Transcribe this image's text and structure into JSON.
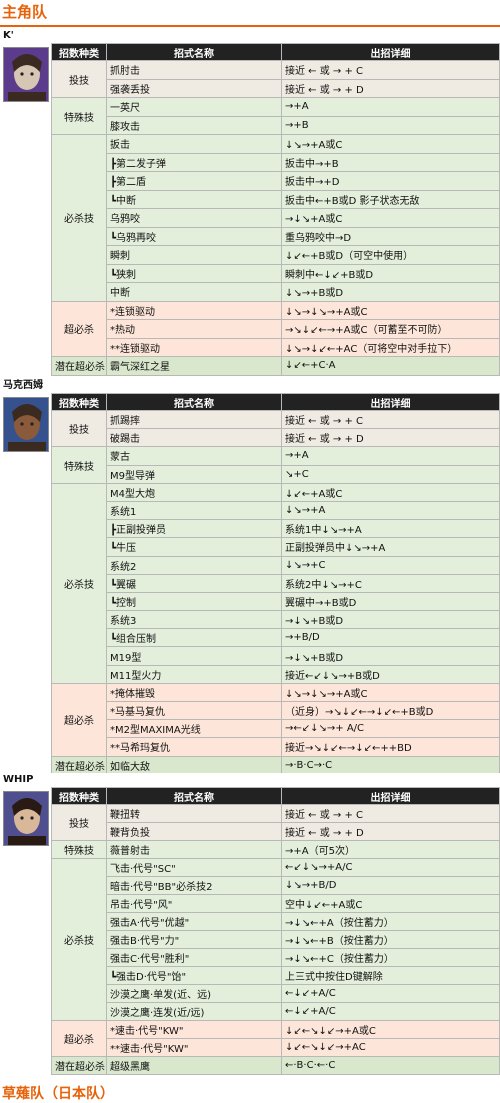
{
  "team_title": "主角队",
  "headers": [
    "招数种类",
    "招式名称",
    "出招详细"
  ],
  "characters": [
    {
      "name": "K'",
      "groups": [
        {
          "type": "投技",
          "rows": [
            [
              "抓肘击",
              "接近 ← 或 → + C"
            ],
            [
              "强袭丢投",
              "接近 ← 或 → + D"
            ]
          ]
        },
        {
          "type": "特殊技",
          "rows": [
            [
              "一英尺",
              "→+A"
            ],
            [
              "膝攻击",
              "→+B"
            ]
          ]
        },
        {
          "type": "必杀技",
          "rows": [
            [
              "扳击",
              "↓↘→+A或C"
            ],
            [
              "┣第二发子弹",
              "扳击中→+B"
            ],
            [
              "┣第二盾",
              "扳击中→+D"
            ],
            [
              "┗中断",
              "扳击中←+B或D 影子状态无敌"
            ],
            [
              "乌鸦咬",
              "→↓↘+A或C"
            ],
            [
              "┗乌鸦再咬",
              "重乌鸦咬中→D"
            ],
            [
              "瞬刺",
              "↓↙←+B或D（可空中使用）"
            ],
            [
              "┗狭刺",
              "瞬刺中←↓↙+B或D"
            ],
            [
              "中断",
              "↓↘→+B或D"
            ]
          ]
        },
        {
          "type": "超必杀",
          "rows": [
            [
              "*连锁驱动",
              "↓↘→↓↘→+A或C"
            ],
            [
              "*热动",
              "→↘↓↙←→+A或C（可蓄至不可防）"
            ],
            [
              "**连锁驱动",
              "↓↘→↓↙←+AC（可将空中对手拉下）"
            ]
          ]
        },
        {
          "type": "潜在超必杀",
          "rows": [
            [
              "霸气深红之星",
              "↓↙←+C·A"
            ]
          ]
        }
      ]
    },
    {
      "name": "马克西姆",
      "groups": [
        {
          "type": "投技",
          "rows": [
            [
              "抓踢摔",
              "接近 ← 或 → + C"
            ],
            [
              "破踢击",
              "接近 ← 或 → + D"
            ]
          ]
        },
        {
          "type": "特殊技",
          "rows": [
            [
              "蒙古",
              "→+A"
            ],
            [
              "M9型导弹",
              "↘+C"
            ]
          ]
        },
        {
          "type": "必杀技",
          "rows": [
            [
              "M4型大炮",
              "↓↙←+A或C"
            ],
            [
              "系统1",
              "↓↘→+A"
            ],
            [
              "┣正副投弹员",
              "系统1中↓↘→+A"
            ],
            [
              "┗牛压",
              "正副投弹员中↓↘→+A"
            ],
            [
              "系统2",
              "↓↘→+C"
            ],
            [
              "┗翼碾",
              "系统2中↓↘→+C"
            ],
            [
              "┗控制",
              "翼碾中→+B或D"
            ],
            [
              "系统3",
              "→↓↘+B或D"
            ],
            [
              "┗组合压制",
              "→+B/D"
            ],
            [
              "M19型",
              "→↓↘+B或D"
            ],
            [
              "M11型火力",
              "接近←↙↓↘→+B或D"
            ]
          ]
        },
        {
          "type": "超必杀",
          "rows": [
            [
              "*掩体摧毁",
              "↓↘→↓↘→+A或C"
            ],
            [
              "*马基马复仇",
              "（近身）→↘↓↙←→↓↙←+B或D"
            ],
            [
              "*M2型MAXIMA光线",
              "→←↙↓↘→+ A/C"
            ],
            [
              "**马希玛复仇",
              "接近→↘↓↙←→↓↙←++BD"
            ]
          ]
        },
        {
          "type": "潜在超必杀",
          "rows": [
            [
              "如临大敌",
              "→·B·C→·C"
            ]
          ]
        }
      ]
    },
    {
      "name": "WHIP",
      "groups": [
        {
          "type": "投技",
          "rows": [
            [
              "鞭扭转",
              "接近 ← 或 → + C"
            ],
            [
              "鞭背负投",
              "接近 ← 或 → + D"
            ]
          ]
        },
        {
          "type": "特殊技",
          "rows": [
            [
              "薇普射击",
              "→+A（可5次）"
            ]
          ]
        },
        {
          "type": "必杀技",
          "rows": [
            [
              "飞击·代号\"SC\"",
              "←↙↓↘→+A/C"
            ],
            [
              "暗击·代号\"BB\"必杀技2",
              "↓↘→+B/D"
            ],
            [
              "吊击·代号\"风\"",
              "空中↓↙←+A或C"
            ],
            [
              "强击A·代号\"优越\"",
              "→↓↘←+A（按住蓄力）"
            ],
            [
              "强击B·代号\"力\"",
              "→↓↘←+B（按住蓄力）"
            ],
            [
              "强击C·代号\"胜利\"",
              "→↓↘←+C（按住蓄力）"
            ],
            [
              "┗强击D·代号\"饴\"",
              "上三式中按住D键解除"
            ],
            [
              "沙漠之鹰·单发(近、远)",
              "←↓↙+A/C"
            ],
            [
              "沙漠之鹰·连发(近/远)",
              "←↓↙+A/C"
            ]
          ]
        },
        {
          "type": "超必杀",
          "rows": [
            [
              "*速击·代号\"KW\"",
              "↓↙←↘↓↙→+A或C"
            ],
            [
              "**速击·代号\"KW\"",
              "↓↙←↘↓↙→+AC"
            ]
          ]
        },
        {
          "type": "潜在超必杀",
          "rows": [
            [
              "超级黑鹰",
              "←·B·C·←·C"
            ]
          ]
        }
      ]
    }
  ],
  "next_team_partial": "草薙队（日本队）"
}
